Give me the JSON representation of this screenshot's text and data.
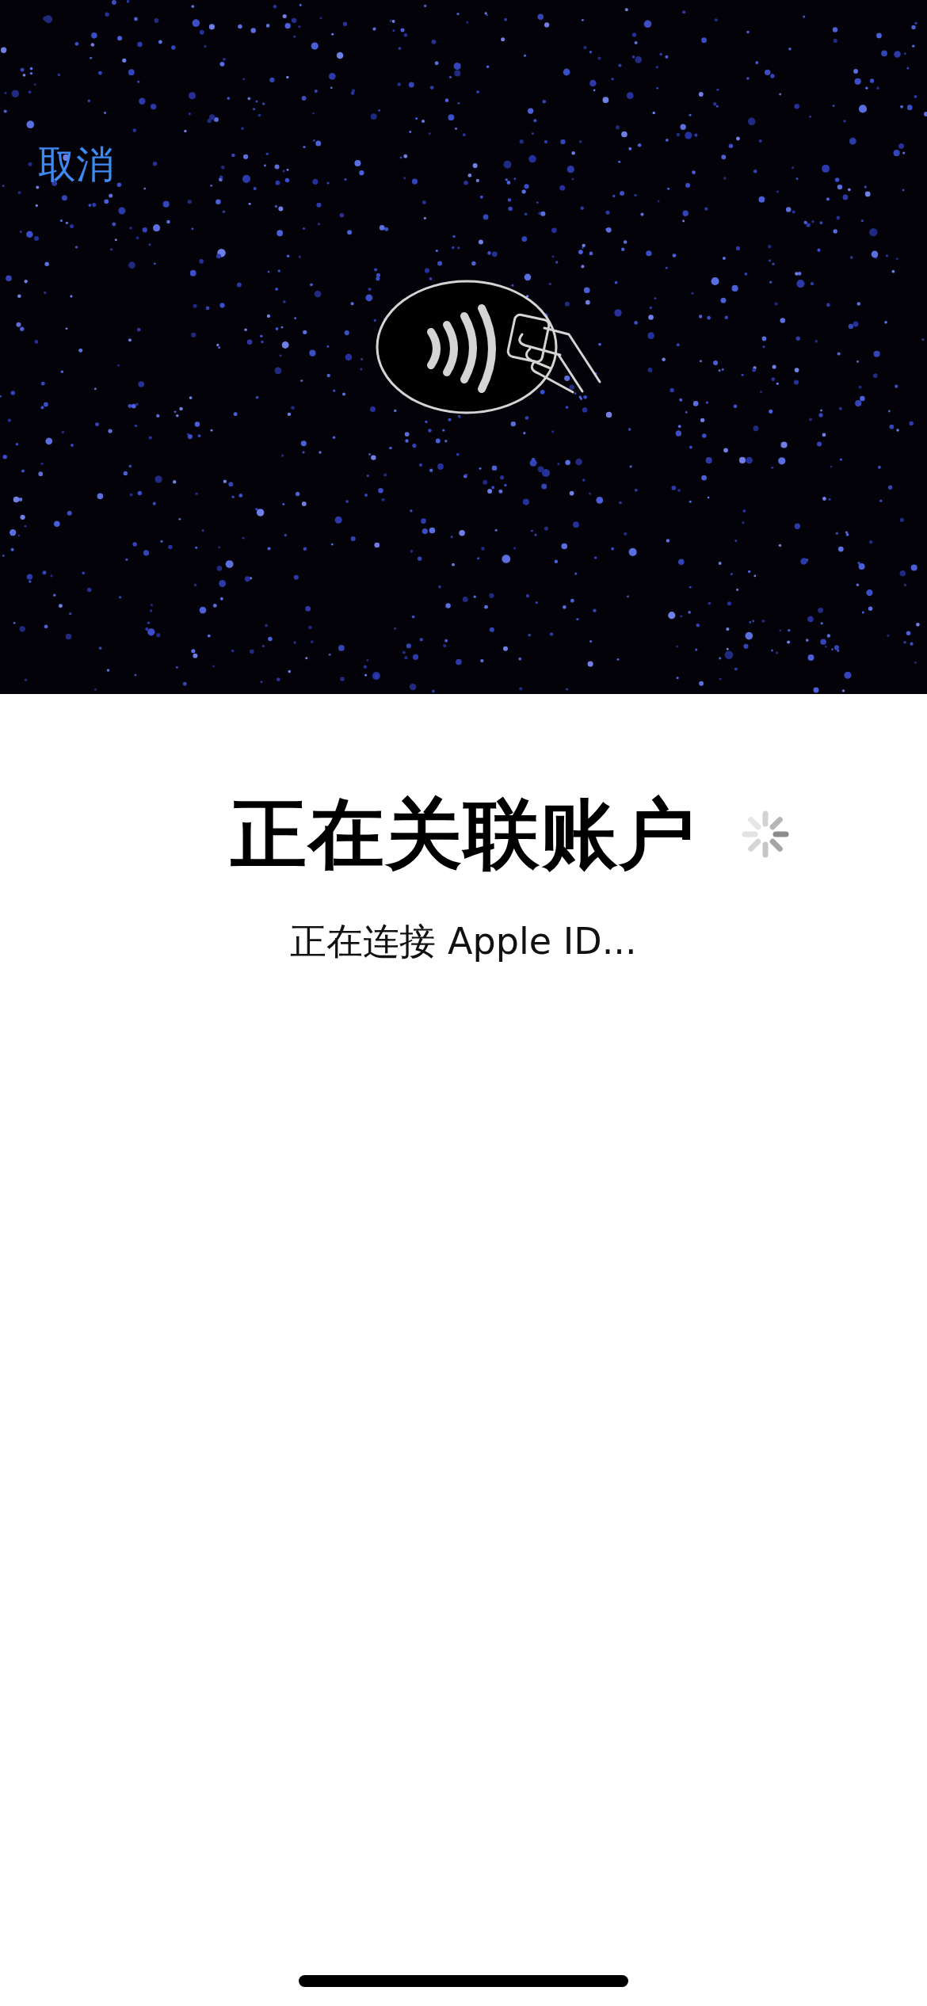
{
  "hero": {
    "cancel_button": "取消"
  },
  "status": {
    "title": "正在关联账户",
    "loading": true,
    "subtitle": "正在连接 Apple ID..."
  }
}
